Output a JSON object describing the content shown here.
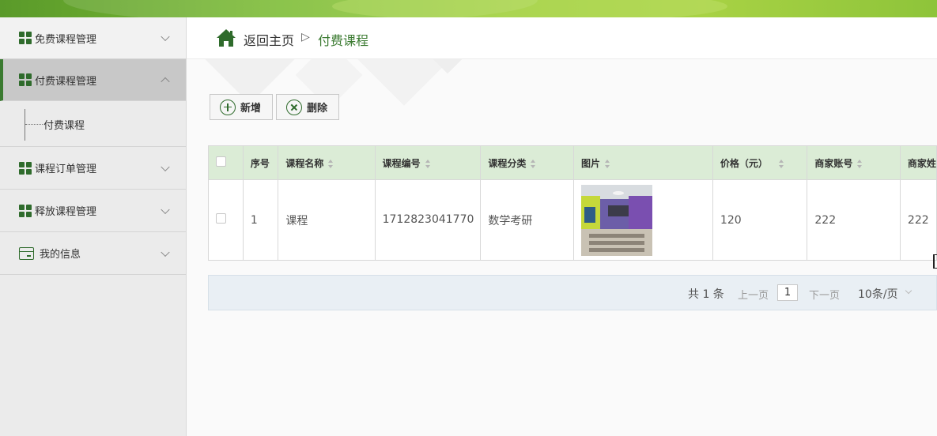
{
  "sidebar": {
    "items": [
      {
        "label": "免费课程管理",
        "icon": "grid-icon",
        "expanded": false
      },
      {
        "label": "付费课程管理",
        "icon": "grid-icon",
        "expanded": true,
        "children": [
          {
            "label": "付费课程"
          }
        ]
      },
      {
        "label": "课程订单管理",
        "icon": "grid-icon",
        "expanded": false
      },
      {
        "label": "释放课程管理",
        "icon": "grid-icon",
        "expanded": false
      },
      {
        "label": "我的信息",
        "icon": "id-card-icon",
        "expanded": false
      }
    ]
  },
  "breadcrumb": {
    "home": "返回主页",
    "separator": "▷",
    "current": "付费课程"
  },
  "toolbar": {
    "add_label": "新增",
    "delete_label": "删除"
  },
  "table": {
    "headers": [
      "序号",
      "课程名称",
      "课程编号",
      "课程分类",
      "图片",
      "价格（元）",
      "商家账号",
      "商家姓"
    ],
    "rows": [
      {
        "index": "1",
        "name": "课程",
        "code": "1712823041770",
        "category": "数学考研",
        "image": "classroom-photo",
        "price": "120",
        "merchant_account": "222",
        "merchant_name": "222"
      }
    ]
  },
  "pagination": {
    "total": "共 1 条",
    "prev": "上一页",
    "page": "1",
    "next": "下一页",
    "page_size": "10条/页"
  },
  "colors": {
    "accent": "#3a7a30",
    "header_bg": "#dbecd6",
    "topbar": "#8ec43a"
  }
}
